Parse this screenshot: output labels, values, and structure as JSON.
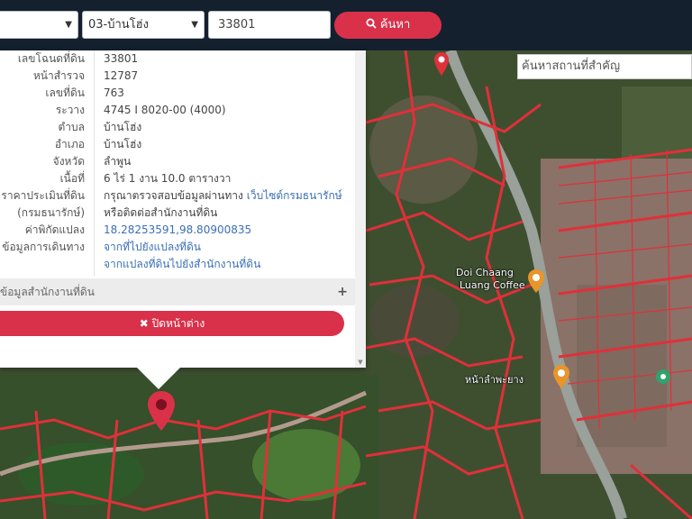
{
  "topbar": {
    "district_select": "03-บ้านโฮ่ง",
    "parcel_input": "33801",
    "search_label": "ค้นหา"
  },
  "map": {
    "search_placeholder": "ค้นหาสถานที่สำคัญ",
    "labels": {
      "cafe_name_1": "Doi Chaang",
      "cafe_name_2": "Luang Coffee",
      "place_south": "หน้าลำพะยาง"
    },
    "colors": {
      "parcel_line": "#e0303a",
      "pin": "#d9314a"
    }
  },
  "panel": {
    "rows": [
      {
        "label": "เลขโฉนดที่ดิน",
        "value": "33801"
      },
      {
        "label": "หน้าสำรวจ",
        "value": "12787"
      },
      {
        "label": "เลขที่ดิน",
        "value": "763"
      },
      {
        "label": "ระวาง",
        "value": "4745 I 8020-00 (4000)"
      },
      {
        "label": "ตำบล",
        "value": "บ้านโฮ่ง"
      },
      {
        "label": "อำเภอ",
        "value": "บ้านโฮ่ง"
      },
      {
        "label": "จังหวัด",
        "value": "ลำพูน"
      },
      {
        "label": "เนื้อที่",
        "value": "6 ไร่ 1 งาน 10.0 ตารางวา"
      },
      {
        "label": "ราคาประเมินที่ดิน",
        "value": "กรุณาตรวจสอบข้อมูลผ่านทาง",
        "link": "เว็บไซต์กรมธนารักษ์"
      },
      {
        "label": "(กรมธนารักษ์)",
        "value": "หรือติดต่อสำนักงานที่ดิน"
      },
      {
        "label": "ค่าพิกัดแปลง",
        "value": "18.28253591,98.80900835"
      },
      {
        "label": "ข้อมูลการเดินทาง",
        "value": "จากที่ไปยังแปลงที่ดิน"
      },
      {
        "label": "",
        "value": "จากแปลงที่ดินไปยังสำนักงานที่ดิน"
      }
    ],
    "office_label": "ข้อมูลสำนักงานที่ดิน",
    "close_label": "ปิดหน้าต่าง"
  }
}
